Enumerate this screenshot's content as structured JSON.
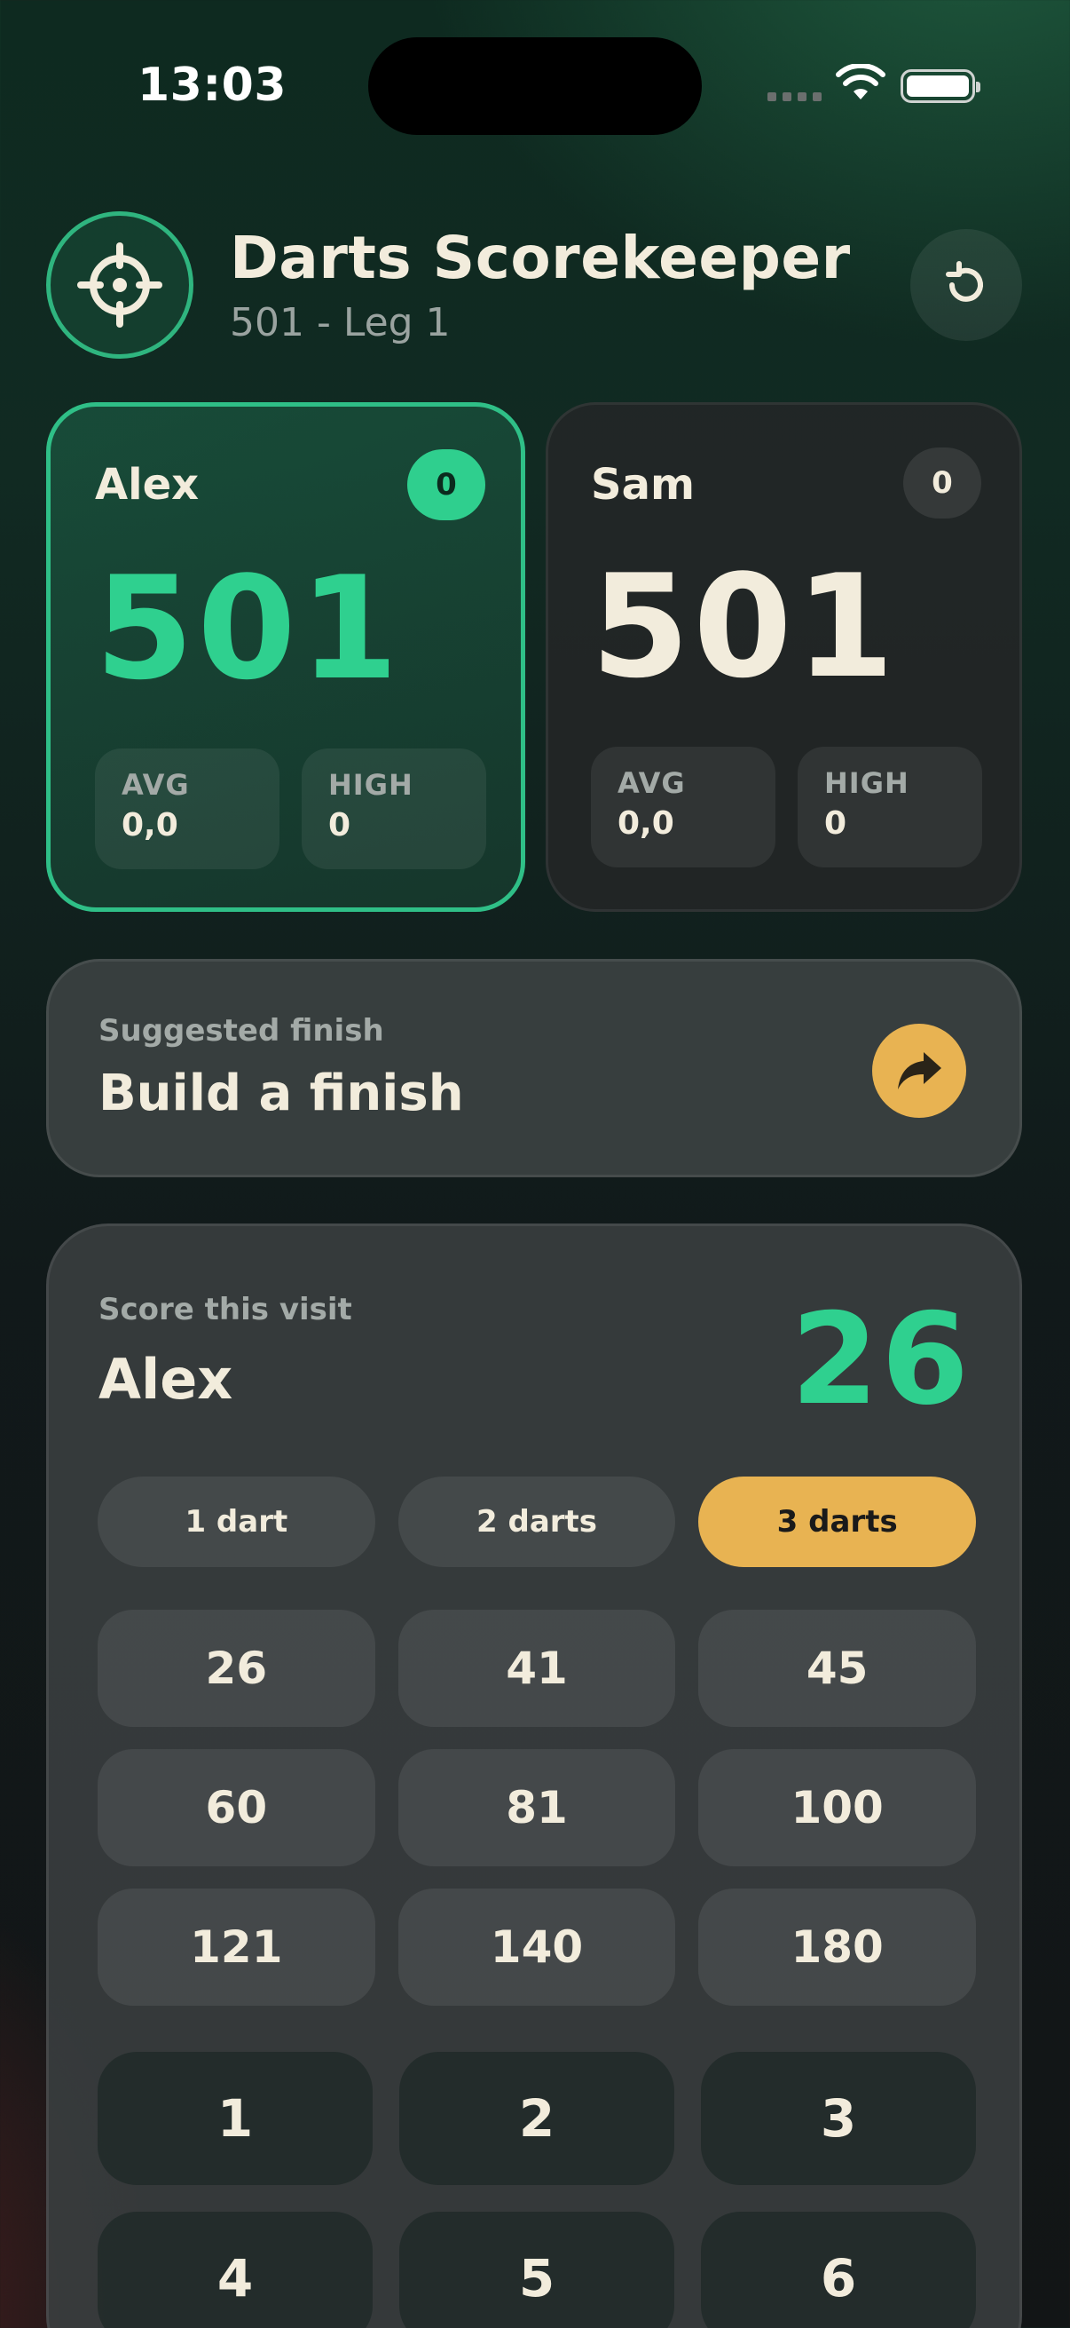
{
  "status_bar": {
    "time": "13:03",
    "icons": [
      "signal-icon",
      "wifi-icon",
      "battery-icon"
    ]
  },
  "header": {
    "title": "Darts Scorekeeper",
    "subtitle": "501 - Leg 1",
    "logo_icon": "crosshair-icon",
    "reset_icon": "rotate-ccw-icon"
  },
  "players": [
    {
      "name": "Alex",
      "legs": "0",
      "score": "501",
      "avg_label": "AVG",
      "avg": "0,0",
      "high_label": "HIGH",
      "high": "0",
      "active": true
    },
    {
      "name": "Sam",
      "legs": "0",
      "score": "501",
      "avg_label": "AVG",
      "avg": "0,0",
      "high_label": "HIGH",
      "high": "0",
      "active": false
    }
  ],
  "finish": {
    "label": "Suggested finish",
    "text": "Build a finish",
    "icon": "share-arrow-icon"
  },
  "entry": {
    "label": "Score this visit",
    "player": "Alex",
    "score": "26",
    "dart_options": [
      "1 dart",
      "2 darts",
      "3 darts"
    ],
    "selected_dart_option": "3 darts",
    "quick_scores": [
      "26",
      "41",
      "45",
      "60",
      "81",
      "100",
      "121",
      "140",
      "180"
    ],
    "keypad": [
      "1",
      "2",
      "3",
      "4",
      "5",
      "6"
    ]
  },
  "colors": {
    "accent_green": "#2fd08f",
    "accent_amber": "#e8b352",
    "text": "#f2ecdc",
    "muted": "#a3aaa7"
  }
}
